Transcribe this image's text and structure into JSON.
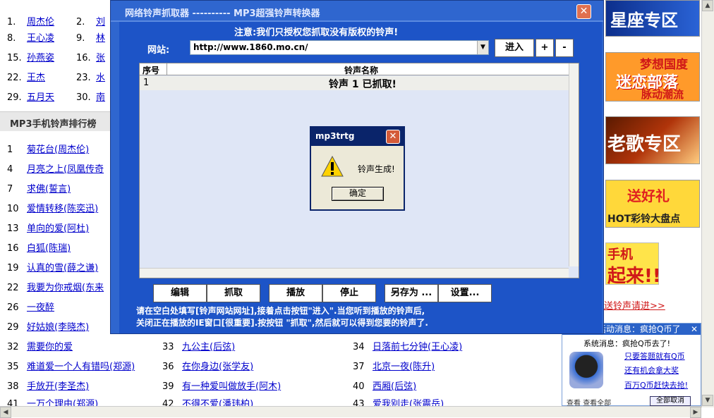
{
  "background": {
    "top_ranks": [
      {
        "n": "1.",
        "t": "周杰伦"
      },
      {
        "n": "2.",
        "t": "刘"
      },
      {
        "n": "8.",
        "t": "王心凌"
      },
      {
        "n": "9.",
        "t": "林"
      },
      {
        "n": "15.",
        "t": "孙燕姿"
      },
      {
        "n": "16.",
        "t": "张"
      },
      {
        "n": "22.",
        "t": "王杰"
      },
      {
        "n": "23.",
        "t": "水"
      },
      {
        "n": "29.",
        "t": "五月天"
      },
      {
        "n": "30.",
        "t": "南"
      }
    ],
    "section_title": "MP3手机铃声排行榜",
    "ringtones": [
      {
        "n": "1",
        "t": "菊花台(周杰伦)"
      },
      {
        "n": "4",
        "t": "月亮之上(凤凰传奇"
      },
      {
        "n": "7",
        "t": "求佛(誓言)"
      },
      {
        "n": "10",
        "t": "爱情转移(陈奕迅)"
      },
      {
        "n": "13",
        "t": "单向的爱(阿杜)"
      },
      {
        "n": "16",
        "t": "白狐(陈瑞)"
      },
      {
        "n": "19",
        "t": "认真的雪(薛之谦)"
      },
      {
        "n": "22",
        "t": "我要为你戒烟(东来"
      },
      {
        "n": "26",
        "t": "一夜醉"
      },
      {
        "n": "29",
        "t": "好姑娘(李晓杰)"
      },
      {
        "n": "32",
        "t": "需要你的爱"
      },
      {
        "n": "35",
        "t": "难道爱一个人有错吗(郑源)"
      },
      {
        "n": "38",
        "t": "手放开(李圣杰)"
      },
      {
        "n": "41",
        "t": "一万个理由(郑源)"
      }
    ],
    "ringtones_col2": [
      {
        "n": "33",
        "t": "九公主(后弦)"
      },
      {
        "n": "36",
        "t": "在你身边(张学友)"
      },
      {
        "n": "39",
        "t": "有一种爱叫做放手(阿木)"
      },
      {
        "n": "42",
        "t": "不得不爱(潘玮柏)"
      }
    ],
    "ringtones_col3": [
      {
        "n": "34",
        "t": "日落前七分钟(王心凌)"
      },
      {
        "n": "37",
        "t": "北京一夜(陈升)"
      },
      {
        "n": "40",
        "t": "西厢(后弦)"
      },
      {
        "n": "43",
        "t": "爱我别走(张震岳)"
      }
    ],
    "banners": {
      "b1": "星座专区",
      "b2a": "梦想国度",
      "b2b": "迷恋部落",
      "b2c": "脉动潮流",
      "b3": "老歌专区",
      "b4a": "送好礼",
      "b4b": "HOT彩铃大盘点",
      "b5a": "手机",
      "b5b": "起来!!",
      "send_link": "送铃声请进>>"
    },
    "qq_box": {
      "title": "活动消息：疯抢Q币了",
      "line0": "系统消息：疯抢Q币去了!",
      "line1": "只要答题就有Q币",
      "line2": "还有机会拿大奖",
      "line3": "百万Q币赶快去抢!",
      "footer_left": "查看",
      "footer_mid": "查看全部",
      "footer_btn": "全部取消"
    }
  },
  "dialog": {
    "title": "网络铃声抓取器 ---------- MP3超强铃声转换器",
    "close": "✕",
    "notice": "注意:我们只授权您抓取没有版权的铃声!",
    "site_label": "网站:",
    "site_value": "http://www.1860.mo.cn/",
    "btn_enter": "进入",
    "btn_plus": "+",
    "btn_minus": "-",
    "col_num": "序号",
    "col_name": "铃声名称",
    "row_num": "1",
    "row_name": "铃声 1 已抓取!",
    "btn_edit": "编辑",
    "btn_grab": "抓取",
    "btn_play": "播放",
    "btn_stop": "停止",
    "btn_saveas": "另存为 ...",
    "btn_settings": "设置...",
    "instr1": "请在空白处填写[铃声网站网址],接着点击按钮\"进入\".当您听到播放的铃声后,",
    "instr2": "关闭正在播放的IE窗口[很重要].按按钮 \"抓取\",然后就可以得到您要的铃声了."
  },
  "msgbox": {
    "title": "mp3trtg",
    "text": "铃声生成!",
    "ok": "确定"
  }
}
